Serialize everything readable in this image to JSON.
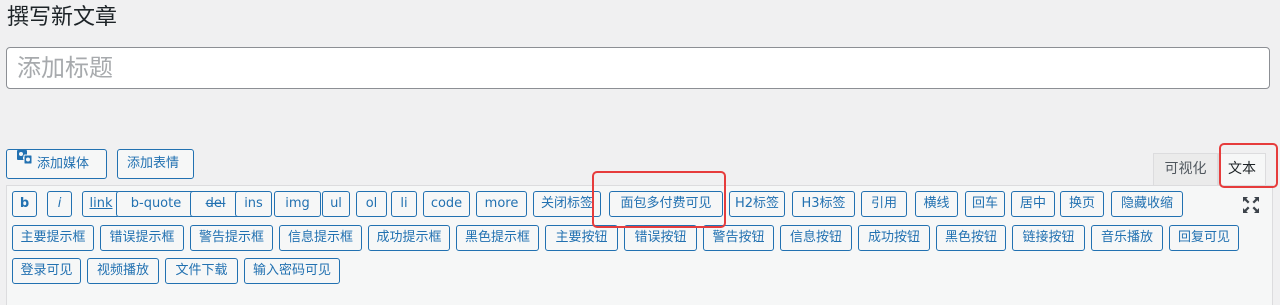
{
  "page": {
    "title": "撰写新文章"
  },
  "post_title": {
    "placeholder": "添加标题"
  },
  "media_buttons": [
    {
      "label": "添加媒体",
      "icon": "media-icon"
    },
    {
      "label": "添加表情"
    }
  ],
  "mode_tabs": [
    {
      "label": "可视化",
      "active": false
    },
    {
      "label": "文本",
      "active": true
    }
  ],
  "quicktags": {
    "row1": [
      "b",
      "i",
      "link",
      "b-quote",
      "del",
      "ins",
      "img",
      "ul",
      "ol",
      "li",
      "code",
      "more",
      "关闭标签",
      "面包多付费可见",
      "H2标签",
      "H3标签",
      "引用",
      "横线",
      "回车",
      "居中",
      "换页",
      "隐藏收缩"
    ],
    "row2": [
      "主要提示框",
      "错误提示框",
      "警告提示框",
      "信息提示框",
      "成功提示框",
      "黑色提示框",
      "主要按钮",
      "错误按钮",
      "警告按钮",
      "信息按钮",
      "成功按钮",
      "黑色按钮",
      "链接按钮",
      "音乐播放",
      "回复可见"
    ],
    "row3": [
      "登录可见",
      "视频播放",
      "文件下载",
      "输入密码可见"
    ]
  },
  "icons": {
    "fullscreen": "fullscreen-icon"
  },
  "colors": {
    "accent": "#2271b1",
    "highlight": "#e63c3c",
    "background": "#f0f0f1"
  }
}
